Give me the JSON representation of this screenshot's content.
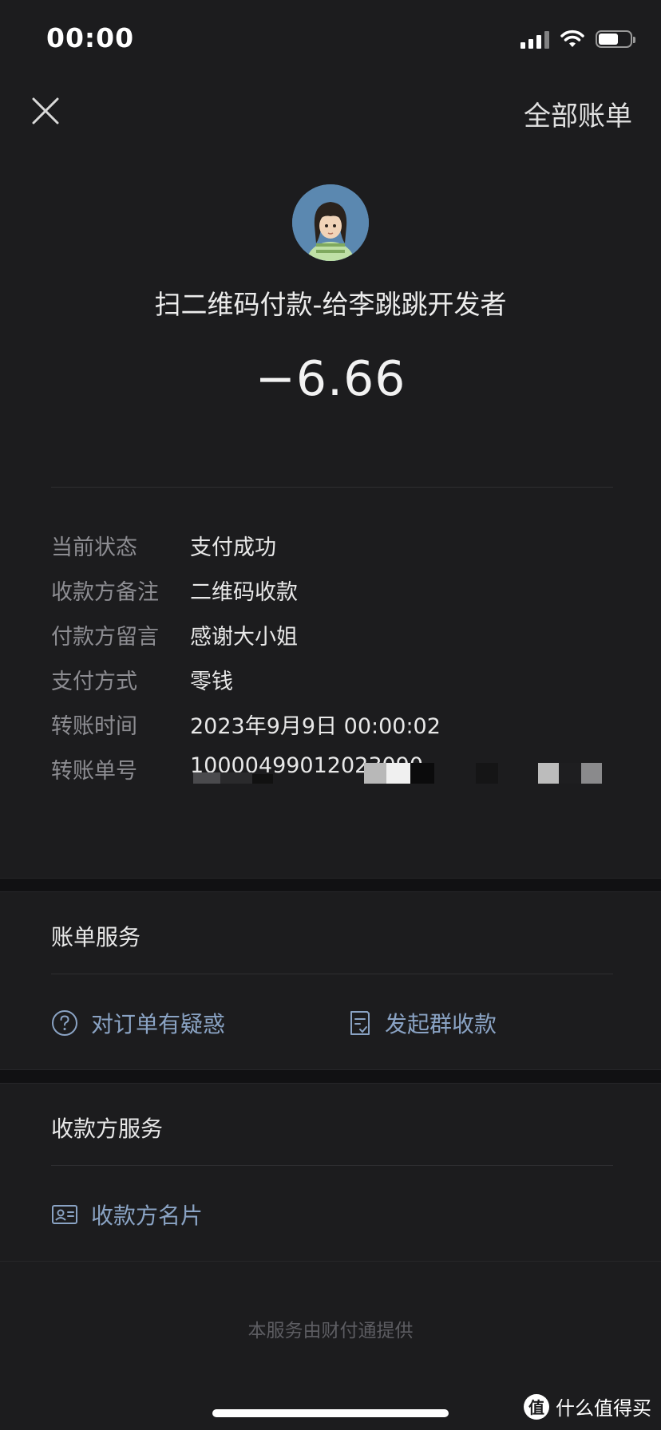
{
  "status_bar": {
    "time": "00:00"
  },
  "nav": {
    "all_bills_label": "全部账单"
  },
  "header": {
    "merchant_title": "扫二维码付款-给李跳跳开发者",
    "amount": "−6.66"
  },
  "details": [
    {
      "label": "当前状态",
      "value": "支付成功"
    },
    {
      "label": "收款方备注",
      "value": "二维码收款"
    },
    {
      "label": "付款方留言",
      "value": "感谢大小姐"
    },
    {
      "label": "支付方式",
      "value": "零钱"
    },
    {
      "label": "转账时间",
      "value": "2023年9月9日 00:00:02"
    },
    {
      "label": "转账单号",
      "value": "10000499012023090"
    }
  ],
  "bill_service": {
    "title": "账单服务",
    "items": [
      {
        "label": "对订单有疑惑",
        "icon": "question-circle-icon"
      },
      {
        "label": "发起群收款",
        "icon": "receipt-icon"
      }
    ]
  },
  "payee_service": {
    "title": "收款方服务",
    "items": [
      {
        "label": "收款方名片",
        "icon": "id-card-icon"
      }
    ]
  },
  "footer": {
    "text": "本服务由财付通提供"
  },
  "watermark": {
    "badge": "值",
    "text": "什么值得买"
  },
  "colors": {
    "background": "#1c1c1e",
    "link": "#8aa3c4",
    "label": "#8d8d92"
  }
}
